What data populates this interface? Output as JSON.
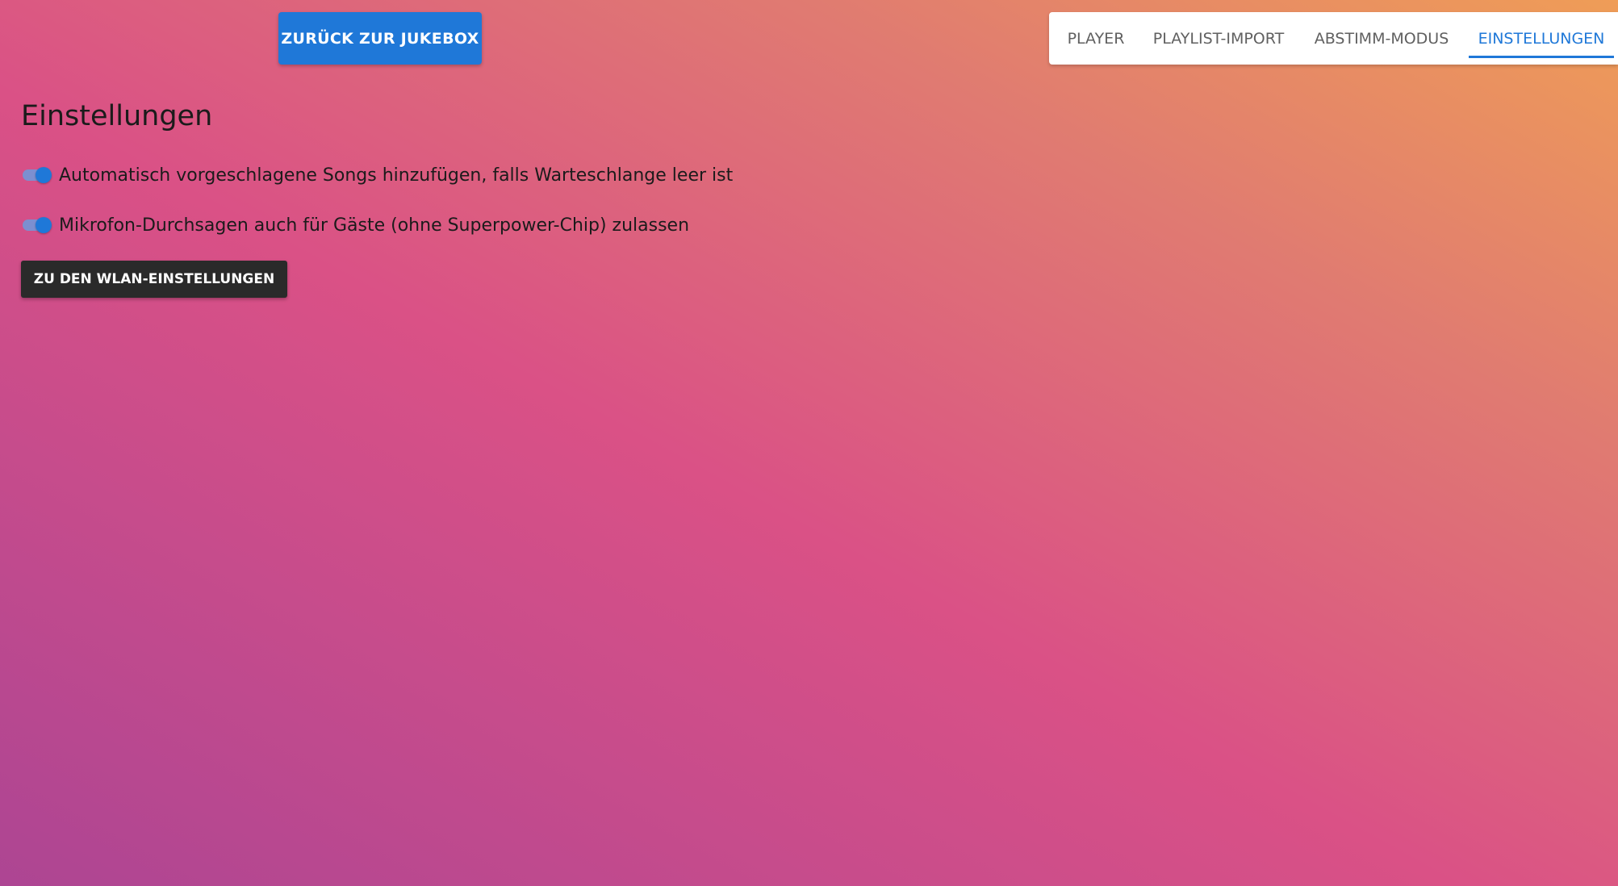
{
  "header": {
    "back_button_label": "ZURÜCK ZUR JUKEBOX",
    "tabs": [
      {
        "label": "PLAYER",
        "active": false
      },
      {
        "label": "PLAYLIST-IMPORT",
        "active": false
      },
      {
        "label": "ABSTIMM-MODUS",
        "active": false
      },
      {
        "label": "EINSTELLUNGEN",
        "active": true
      }
    ]
  },
  "main": {
    "title": "Einstellungen",
    "settings": [
      {
        "label": "Automatisch vorgeschlagene Songs hinzufügen, falls Warteschlange leer ist",
        "enabled": true
      },
      {
        "label": "Mikrofon-Durchsagen auch für Gäste (ohne Superpower-Chip) zulassen",
        "enabled": true
      }
    ],
    "wlan_button_label": "ZU DEN WLAN-EINSTELLUNGEN"
  },
  "colors": {
    "accent": "#1f78d8",
    "dark_button": "#2a2a2a",
    "gradient": [
      "#ad4593",
      "#da5186",
      "#ef9d57"
    ]
  }
}
